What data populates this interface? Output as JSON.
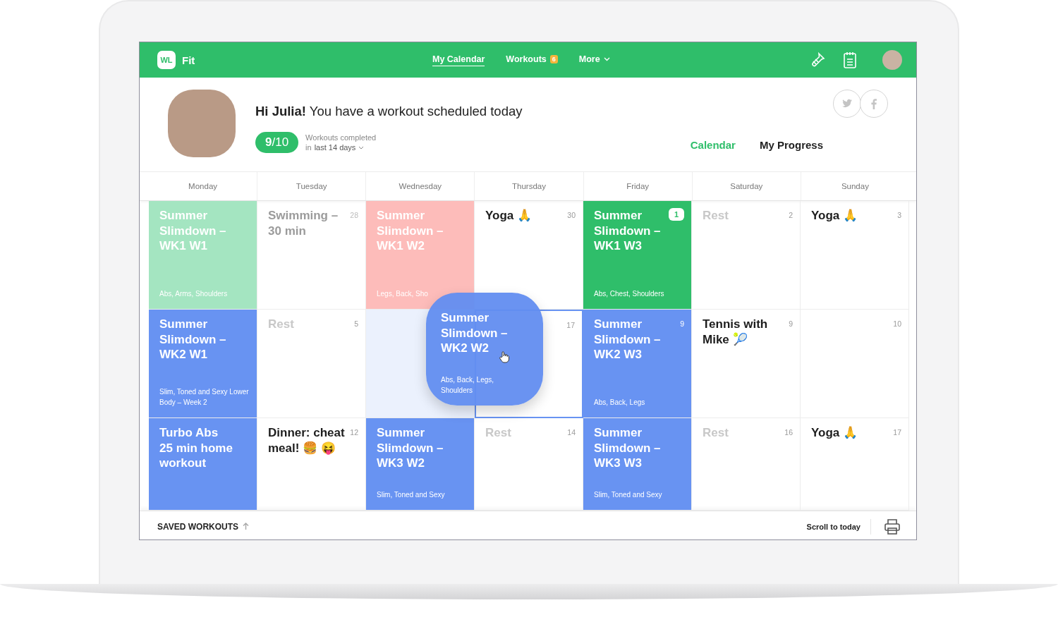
{
  "app": {
    "logo": "WL",
    "name": "Fit"
  },
  "nav": [
    {
      "label": "My Calendar",
      "selected": true
    },
    {
      "label": "Workouts",
      "badge": "6",
      "selected": false
    },
    {
      "label": "More",
      "dropdown": true,
      "selected": false
    }
  ],
  "profile": {
    "greeting": "**Hi Julia!** You have a workout scheduled today",
    "score": "**9**/10",
    "stats_label": "Workouts completed",
    "period_prefix": "in",
    "period": "last 14 days"
  },
  "view_tabs": [
    {
      "label": "Calendar",
      "selected": true
    },
    {
      "label": "My Progress",
      "selected": false
    }
  ],
  "weekdays": [
    "Monday",
    "Tuesday",
    "Wednesday",
    "Thursday",
    "Friday",
    "Saturday",
    "Sunday"
  ],
  "cells": [
    {
      "kind": "workout",
      "color": "#a4e5c1",
      "title": "Summer Slimdown – WK1 W1",
      "subtitle": "Abs, Arms, Shoulders"
    },
    {
      "kind": "past",
      "title": "Swimming – 30 min",
      "day": "28"
    },
    {
      "kind": "workout",
      "color": "#fdbcba",
      "title": "Summer Slimdown – WK1 W2",
      "subtitle": "Legs, Back, Sho"
    },
    {
      "kind": "event",
      "title": "Yoga 🙏",
      "day": "30"
    },
    {
      "kind": "workout",
      "color": "#2fbe6a",
      "title": "Summer Slimdown – WK1 W3",
      "badge": "1",
      "subtitle": "Abs, Chest, Shoulders"
    },
    {
      "kind": "rest",
      "title": "Rest",
      "day": "2"
    },
    {
      "kind": "event",
      "title": "Yoga 🙏",
      "day": "3"
    },
    {
      "kind": "workout",
      "color": "#6893f2",
      "title": "Summer Slimdown – WK2 W1",
      "subtitle": "Slim, Toned and Sexy Lower Body – Week 2"
    },
    {
      "kind": "rest",
      "title": "Rest",
      "day": "5"
    },
    {
      "kind": "source"
    },
    {
      "kind": "target",
      "day": "17"
    },
    {
      "kind": "workout",
      "color": "#6893f2",
      "title": "Summer Slimdown – WK2 W3",
      "day": "9",
      "subtitle": "Abs, Back, Legs"
    },
    {
      "kind": "event",
      "title": "Tennis with Mike 🎾",
      "day": "9"
    },
    {
      "kind": "blank",
      "day": "10"
    },
    {
      "kind": "workout",
      "color": "#6893f2",
      "title": "Turbo Abs\n25 min home workout"
    },
    {
      "kind": "event",
      "title": "Dinner: cheat meal! 🍔 😝",
      "day": "12"
    },
    {
      "kind": "workout",
      "color": "#6893f2",
      "title": "Summer Slimdown – WK3 W2",
      "subtitle": "Slim, Toned and Sexy"
    },
    {
      "kind": "rest",
      "title": "Rest",
      "day": "14"
    },
    {
      "kind": "workout",
      "color": "#6893f2",
      "title": "Summer Slimdown – WK3 W3",
      "subtitle": "Slim, Toned and Sexy"
    },
    {
      "kind": "rest",
      "title": "Rest",
      "day": "16"
    },
    {
      "kind": "event",
      "title": "Yoga 🙏",
      "day": "17"
    }
  ],
  "dragged_card": {
    "title": "Summer Slimdown – WK2 W2",
    "subtitle": "Abs, Back, Legs, Shoulders"
  },
  "footer": {
    "saved": "SAVED WORKOUTS",
    "scroll": "Scroll to today"
  }
}
